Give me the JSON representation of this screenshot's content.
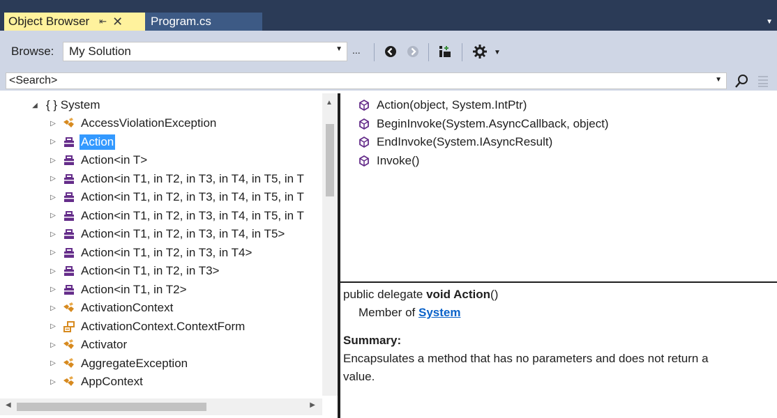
{
  "tabs": {
    "active_label": "Object Browser",
    "pin_glyph": "⇤",
    "close_glyph": "✕",
    "inactive_label": "Program.cs"
  },
  "toolbar": {
    "browse_label": "Browse:",
    "browse_value": "My Solution",
    "ellipsis": "...",
    "icons": [
      "back-icon",
      "forward-icon",
      "add-reference-icon",
      "settings-icon"
    ]
  },
  "search": {
    "placeholder": "<Search>"
  },
  "tree": {
    "root": {
      "expander": "◢",
      "label": "{ } System"
    },
    "items": [
      {
        "label": "AccessViolationException",
        "icon": "class-icon"
      },
      {
        "label": "Action",
        "icon": "delegate-icon",
        "selected": true
      },
      {
        "label": "Action<in T>",
        "icon": "delegate-icon"
      },
      {
        "label": "Action<in T1, in T2, in T3, in T4, in T5, in T",
        "icon": "delegate-icon"
      },
      {
        "label": "Action<in T1, in T2, in T3, in T4, in T5, in T",
        "icon": "delegate-icon"
      },
      {
        "label": "Action<in T1, in T2, in T3, in T4, in T5, in T",
        "icon": "delegate-icon"
      },
      {
        "label": "Action<in T1, in T2, in T3, in T4, in T5>",
        "icon": "delegate-icon"
      },
      {
        "label": "Action<in T1, in T2, in T3, in T4>",
        "icon": "delegate-icon"
      },
      {
        "label": "Action<in T1, in T2, in T3>",
        "icon": "delegate-icon"
      },
      {
        "label": "Action<in T1, in T2>",
        "icon": "delegate-icon"
      },
      {
        "label": "ActivationContext",
        "icon": "class-icon"
      },
      {
        "label": "ActivationContext.ContextForm",
        "icon": "enum-icon"
      },
      {
        "label": "Activator",
        "icon": "class-icon"
      },
      {
        "label": "AggregateException",
        "icon": "class-icon"
      },
      {
        "label": "AppContext",
        "icon": "class-icon"
      }
    ]
  },
  "members": [
    "Action(object, System.IntPtr)",
    "BeginInvoke(System.AsyncCallback, object)",
    "EndInvoke(System.IAsyncResult)",
    "Invoke()"
  ],
  "description": {
    "signature_prefix": "public delegate ",
    "signature_bold": "void Action",
    "signature_suffix": "()",
    "member_of_prefix": "Member of ",
    "member_of_link": "System",
    "summary_heading": "Summary:",
    "summary_line1": "Encapsulates a method that has no parameters and does not return a",
    "summary_line2": "value."
  },
  "colors": {
    "tab_strip": "#2b3b57",
    "active_tab": "#fff29d",
    "toolbar": "#cfd6e5",
    "selection": "#3399ff",
    "link": "#0a62c9"
  }
}
